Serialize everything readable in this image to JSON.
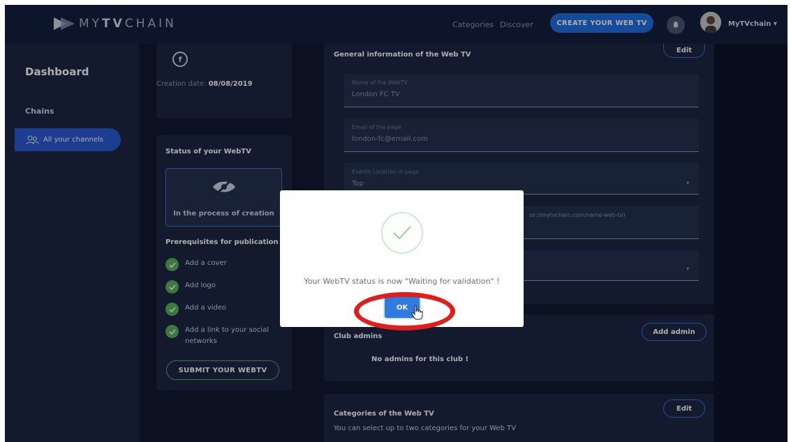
{
  "app": {
    "logo_text_light": "MY",
    "logo_text_bold": "TV",
    "logo_text_rest": "CHAIN",
    "nav_categories": "Categories",
    "nav_discover": "Discover",
    "create_button": "CREATE YOUR WEB TV",
    "username": "MyTVchain"
  },
  "sidebar": {
    "title": "Dashboard",
    "section": "Chains",
    "items": [
      {
        "label": "All your channels",
        "icon": "users-icon",
        "active": true
      }
    ]
  },
  "left_panel": {
    "social_icon": "facebook-icon",
    "creation_label": "Creation date:",
    "creation_date": "08/08/2019",
    "status_title": "Status of your WebTV",
    "status_icon": "hidden-eye-icon",
    "status_text": "In the process of creation",
    "prereq_title": "Prerequisites for publication",
    "prerequisites": [
      {
        "label": "Add a cover",
        "done": true
      },
      {
        "label": "Add logo",
        "done": true
      },
      {
        "label": "Add a video",
        "done": true
      },
      {
        "label": "Add a link to your social networks",
        "done": true
      }
    ],
    "submit_button": "SUBMIT YOUR WEBTV"
  },
  "general_info": {
    "title": "General information of the Web TV",
    "edit_button": "Edit",
    "fields": [
      {
        "label": "Name of the WebTV",
        "value": "London FC TV"
      },
      {
        "label": "Email of the page",
        "value": "london-fc@email.com"
      },
      {
        "label": "Events Location in page",
        "value": "Top",
        "dropdown": true
      },
      {
        "label": "",
        "value": "",
        "partial_text": "os://mytvchain.com/name-web-tv)"
      },
      {
        "label": "",
        "value": "",
        "dropdown": true
      }
    ]
  },
  "admins": {
    "title": "Club admins",
    "add_button": "Add admin",
    "empty_text": "No admins for this club !"
  },
  "categories": {
    "title": "Categories of the Web TV",
    "edit_button": "Edit",
    "subtitle": "You can select up to two categories for your Web TV"
  },
  "modal": {
    "icon": "success-check-icon",
    "message": "Your WebTV status is now \"Waiting for validation\" !",
    "ok_button": "OK"
  },
  "colors": {
    "accent": "#1f6fe0",
    "success": "#57b35a",
    "highlight": "#e01e1e"
  }
}
